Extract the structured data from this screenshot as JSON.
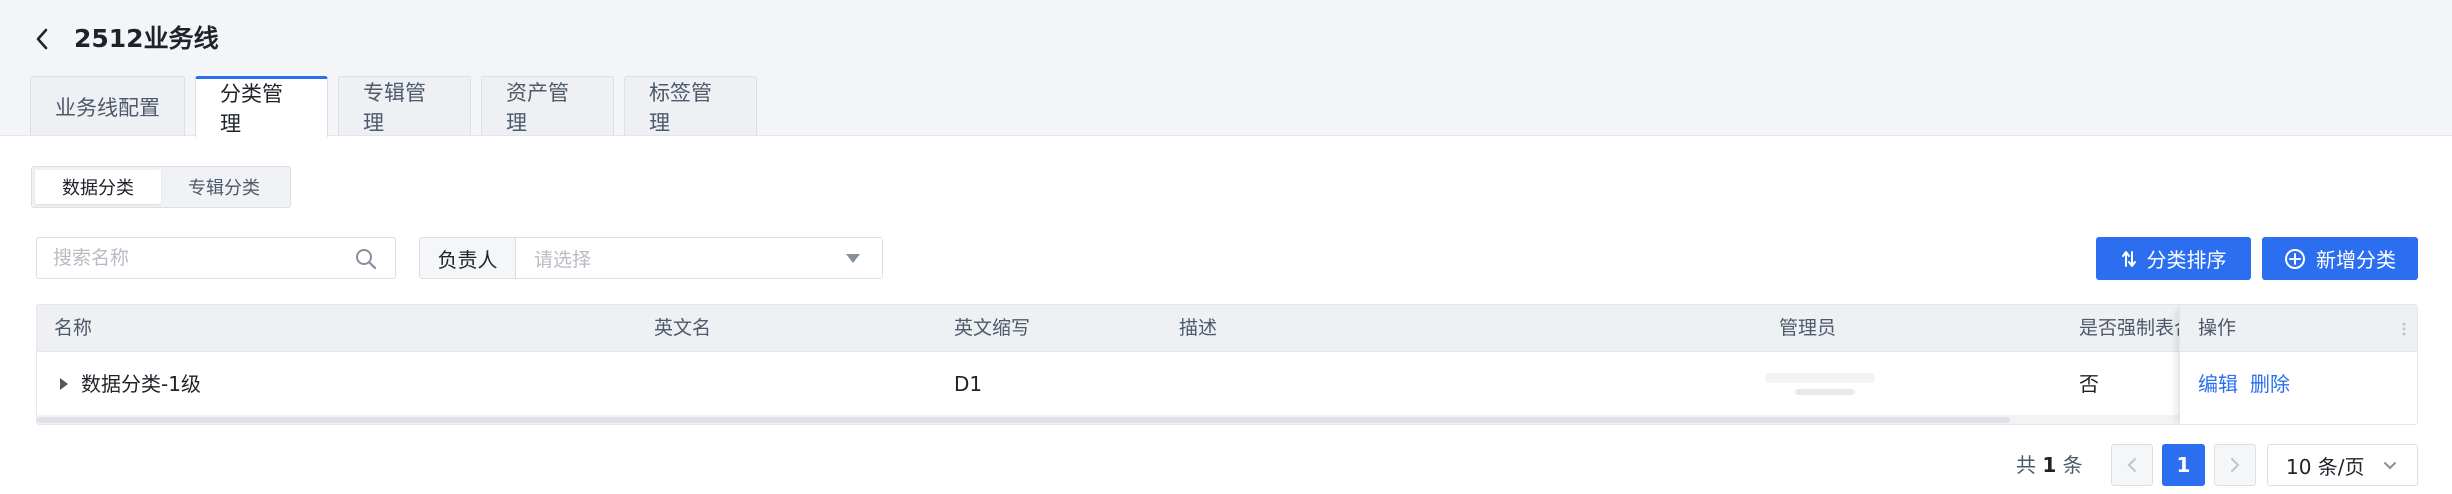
{
  "header": {
    "title": "2512业务线",
    "tabs": [
      {
        "label": "业务线配置",
        "active": false
      },
      {
        "label": "分类管理",
        "active": true
      },
      {
        "label": "专辑管理",
        "active": false
      },
      {
        "label": "资产管理",
        "active": false
      },
      {
        "label": "标签管理",
        "active": false
      }
    ]
  },
  "segment": {
    "items": [
      {
        "label": "数据分类",
        "active": true
      },
      {
        "label": "专辑分类",
        "active": false
      }
    ]
  },
  "filters": {
    "search_placeholder": "搜索名称",
    "owner_label": "负责人",
    "owner_placeholder": "请选择"
  },
  "actions": {
    "sort_label": "分类排序",
    "add_label": "新增分类"
  },
  "table": {
    "columns": [
      "名称",
      "英文名",
      "英文缩写",
      "描述",
      "管理员",
      "是否强制表合",
      "操作"
    ],
    "rows": [
      {
        "name": "数据分类-1级",
        "english_name": "",
        "abbr": "D1",
        "description": "",
        "admin": "",
        "forced": "否",
        "ops": [
          "编辑",
          "删除"
        ]
      }
    ]
  },
  "pagination": {
    "total_prefix": "共",
    "total_count": "1",
    "total_suffix": "条",
    "current_page": "1",
    "page_size": "10 条/页"
  },
  "colors": {
    "primary": "#2b6ff0",
    "header_bg": "#f3f5f9",
    "table_header_bg": "#eef0f4"
  }
}
